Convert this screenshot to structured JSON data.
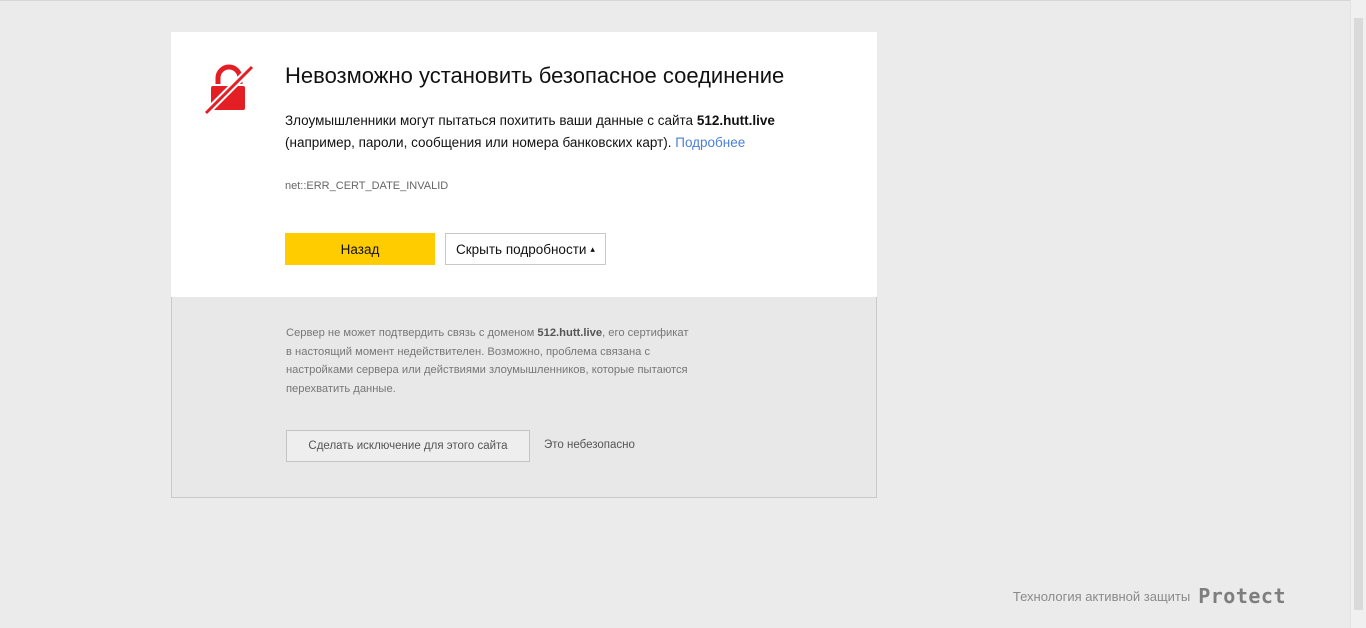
{
  "error": {
    "title": "Невозможно установить безопасное соединение",
    "desc_part1": "Злоумышленники могут пытаться похитить ваши данные с сайта ",
    "domain": "512.hutt.live",
    "desc_part2": "(например, пароли, сообщения или номера банковских карт). ",
    "learn_more": "Подробнее",
    "code": "net::ERR_CERT_DATE_INVALID",
    "icon": "broken-lock-icon",
    "icon_color": "#e31e24"
  },
  "buttons": {
    "back_label": "Назад",
    "back_color": "#ffcc00",
    "details_label": "Скрыть подробности",
    "details_caret": "▴"
  },
  "details": {
    "text_part1": "Сервер не может подтвердить связь с доменом ",
    "domain": "512.hutt.live",
    "text_part2": ", его сертификат в настоящий момент недействителен. Возможно, проблема связана с настройками сервера или действиями злоумышленников, которые пытаются перехватить данные.",
    "exception_button": "Сделать исключение для этого сайта",
    "unsafe_note": "Это небезопасно"
  },
  "footer": {
    "text": "Технология активной защиты",
    "brand": "Protect"
  }
}
